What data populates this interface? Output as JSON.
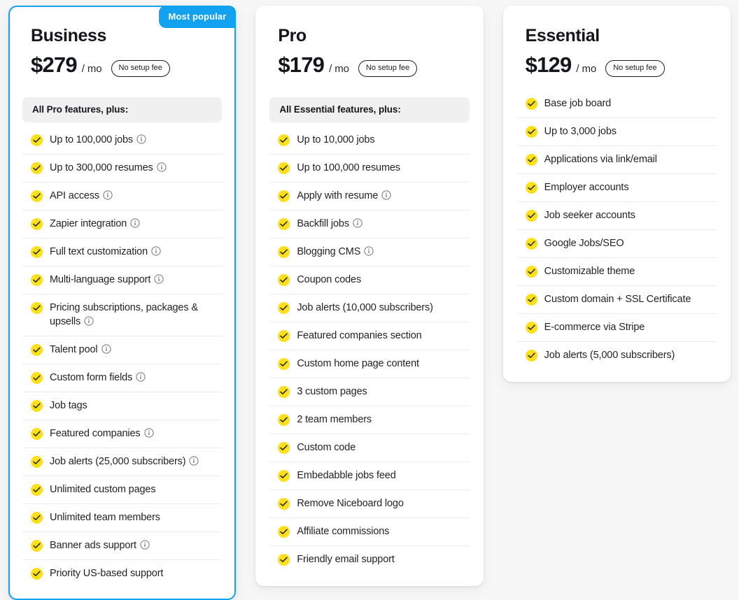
{
  "badge": {
    "most_popular": "Most popular"
  },
  "icons": {
    "check": "check-icon",
    "info": "info-icon"
  },
  "colors": {
    "accent_blue": "#13a2f0",
    "check_yellow": "#ffe01b",
    "section_bar_bg": "#f0f0f0",
    "page_bg": "#f7f7f8",
    "text": "#1f2125",
    "divider": "#ededee"
  },
  "plans": [
    {
      "name": "Business",
      "price": "$279",
      "period": "/ mo",
      "setup_fee_pill": "No setup fee",
      "badge": "Most popular",
      "featured": true,
      "section_header": "All Pro features, plus:",
      "features": [
        {
          "label": "Up to 100,000 jobs",
          "info": true
        },
        {
          "label": "Up to 300,000 resumes",
          "info": true
        },
        {
          "label": "API access",
          "info": true
        },
        {
          "label": "Zapier integration",
          "info": true
        },
        {
          "label": "Full text customization",
          "info": true
        },
        {
          "label": "Multi-language support",
          "info": true
        },
        {
          "label": "Pricing subscriptions, packages & upsells",
          "info": true
        },
        {
          "label": "Talent pool",
          "info": true
        },
        {
          "label": "Custom form fields",
          "info": true
        },
        {
          "label": "Job tags",
          "info": false
        },
        {
          "label": "Featured companies",
          "info": true
        },
        {
          "label": "Job alerts (25,000 subscribers)",
          "info": true
        },
        {
          "label": "Unlimited custom pages",
          "info": false
        },
        {
          "label": "Unlimited team members",
          "info": false
        },
        {
          "label": "Banner ads support",
          "info": true
        },
        {
          "label": "Priority US-based support",
          "info": false
        }
      ]
    },
    {
      "name": "Pro",
      "price": "$179",
      "period": "/ mo",
      "setup_fee_pill": "No setup fee",
      "badge": null,
      "featured": false,
      "section_header": "All Essential features, plus:",
      "features": [
        {
          "label": "Up to 10,000 jobs",
          "info": false
        },
        {
          "label": "Up to 100,000 resumes",
          "info": false
        },
        {
          "label": "Apply with resume",
          "info": true
        },
        {
          "label": "Backfill jobs",
          "info": true
        },
        {
          "label": "Blogging CMS",
          "info": true
        },
        {
          "label": "Coupon codes",
          "info": false
        },
        {
          "label": "Job alerts (10,000 subscribers)",
          "info": false
        },
        {
          "label": "Featured companies section",
          "info": false
        },
        {
          "label": "Custom home page content",
          "info": false
        },
        {
          "label": "3 custom pages",
          "info": false
        },
        {
          "label": "2 team members",
          "info": false
        },
        {
          "label": "Custom code",
          "info": false
        },
        {
          "label": "Embedabble jobs feed",
          "info": false
        },
        {
          "label": "Remove Niceboard logo",
          "info": false
        },
        {
          "label": "Affiliate commissions",
          "info": false
        },
        {
          "label": "Friendly email support",
          "info": false
        }
      ]
    },
    {
      "name": "Essential",
      "price": "$129",
      "period": "/ mo",
      "setup_fee_pill": "No setup fee",
      "badge": null,
      "featured": false,
      "section_header": null,
      "features": [
        {
          "label": "Base job board",
          "info": false
        },
        {
          "label": "Up to 3,000 jobs",
          "info": false
        },
        {
          "label": "Applications via link/email",
          "info": false
        },
        {
          "label": "Employer accounts",
          "info": false
        },
        {
          "label": "Job seeker accounts",
          "info": false
        },
        {
          "label": "Google Jobs/SEO",
          "info": false
        },
        {
          "label": "Customizable theme",
          "info": false
        },
        {
          "label": "Custom domain + SSL Certificate",
          "info": false
        },
        {
          "label": "E-commerce via Stripe",
          "info": false
        },
        {
          "label": "Job alerts (5,000 subscribers)",
          "info": false
        }
      ]
    }
  ]
}
